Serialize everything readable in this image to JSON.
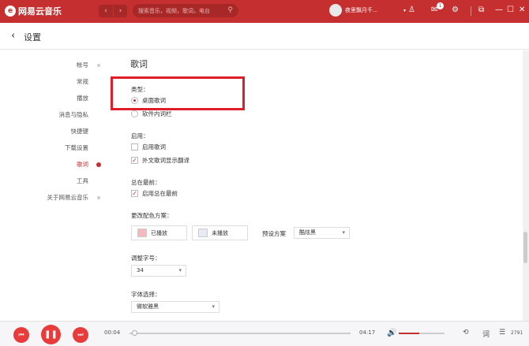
{
  "app": {
    "logo_text": "网易云音乐",
    "logo_glyph": "e"
  },
  "nav": {
    "back_glyph": "‹",
    "forward_glyph": "›"
  },
  "search": {
    "placeholder": "搜索音乐，视频，歌词，电台"
  },
  "user": {
    "name": "夜里飘月千..."
  },
  "titlebar": {
    "message_badge": "1"
  },
  "page": {
    "title": "设置"
  },
  "sidebar": {
    "items": [
      {
        "label": "帐号"
      },
      {
        "label": "常规"
      },
      {
        "label": "播放"
      },
      {
        "label": "消息与隐私"
      },
      {
        "label": "快捷键"
      },
      {
        "label": "下载设置"
      },
      {
        "label": "歌词"
      },
      {
        "label": "工具"
      },
      {
        "label": "关于网易云音乐"
      }
    ],
    "active_index": 6
  },
  "lyrics": {
    "title": "歌词",
    "type": {
      "label": "类型：",
      "options": [
        "桌面歌词",
        "软件内词栏"
      ],
      "selected": 0
    },
    "enable": {
      "label": "启用：",
      "options": [
        {
          "label": "启用歌词",
          "checked": false
        },
        {
          "label": "外文歌词显示翻译",
          "checked": true
        }
      ]
    },
    "ontop": {
      "label": "总在最前：",
      "option": {
        "label": "启用总在最前",
        "checked": true
      }
    },
    "color": {
      "label": "更改配色方案：",
      "played": {
        "label": "已播放",
        "color": "#f3b9bd"
      },
      "unplayed": {
        "label": "未播放",
        "color": "#e9ebf4"
      },
      "preset_label": "预设方案",
      "preset_value": "酷炫黑"
    },
    "fontsize": {
      "label": "调整字号：",
      "value": "34"
    },
    "font": {
      "label": "字体选择：",
      "value": "微软雅黑"
    }
  },
  "player": {
    "current_time": "00:04",
    "total_time": "04:17",
    "progress": 0.02,
    "volume": 0.45,
    "lyric_toggle": "词",
    "playlist_count": "2791"
  },
  "colors": {
    "brand": "#c62f2f",
    "highlight_box": "#e01e2a"
  }
}
